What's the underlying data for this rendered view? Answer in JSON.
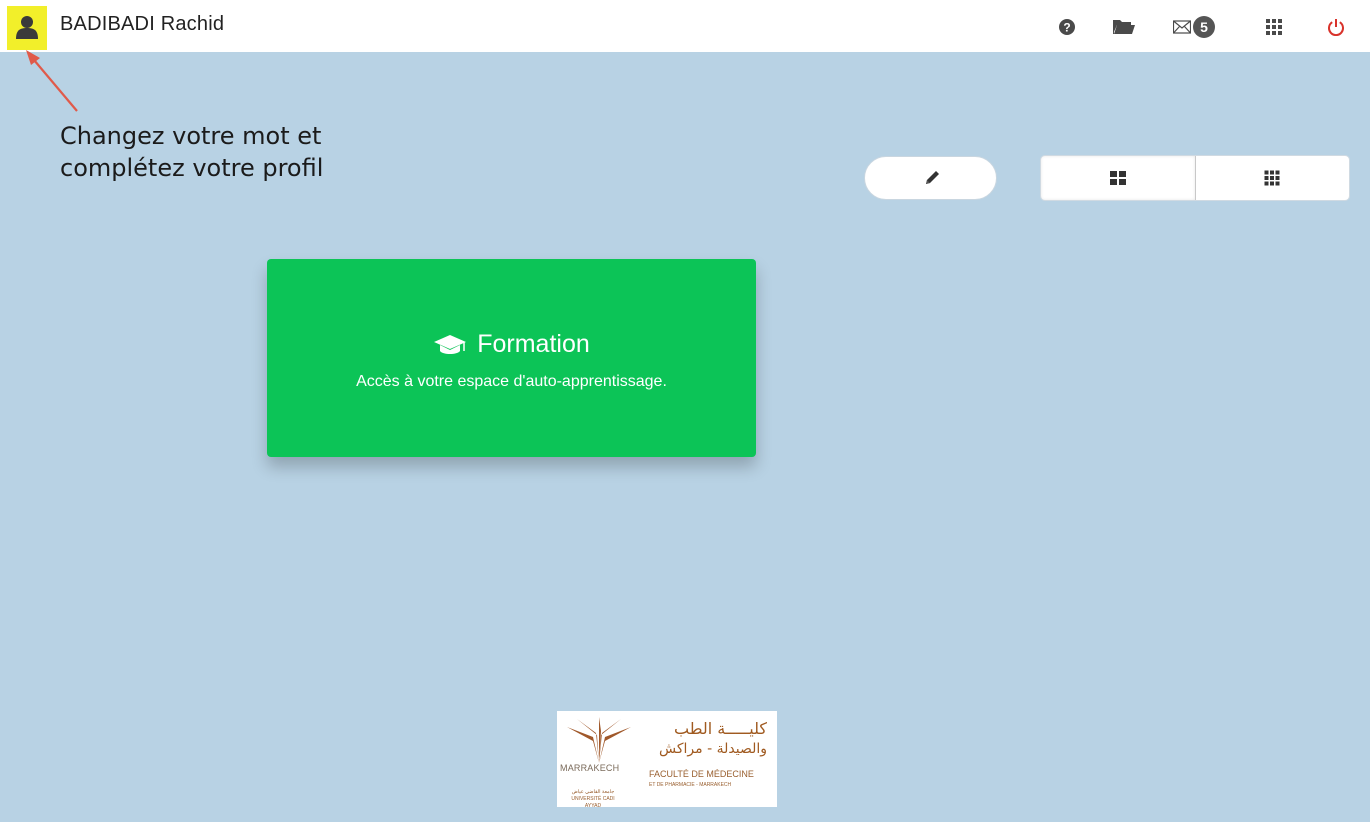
{
  "header": {
    "user_name": "BADIBADI Rachid",
    "mail_count": "5",
    "icons": [
      "user-icon",
      "help-icon",
      "folder-open-icon",
      "mail-icon",
      "apps-grid-icon",
      "power-icon"
    ]
  },
  "annotation": {
    "text": "Changez votre mot et complétez votre profil"
  },
  "toolbar": {
    "icons": [
      "pencil-icon",
      "large-grid-icon",
      "small-grid-icon"
    ]
  },
  "tiles": [
    {
      "title": "Formation",
      "description": "Accès à votre espace d'auto-apprentissage.",
      "icon": "graduation-cap-icon",
      "color": "#0cc457"
    }
  ],
  "footer_logo": {
    "arabic_line1": "كليـــــة الطب",
    "arabic_line2": "والصيدلة - مراكش",
    "french_line1": "FACULTÉ DE MÉDECINE",
    "french_line2": "ET DE PHARMACIE - MARRAKECH",
    "city": "MARRAKECH",
    "university_line1": "جامعة القاضي عياض",
    "university_line2": "UNIVERSITÉ CADI AYYAD"
  },
  "colors": {
    "background": "#b8d2e4",
    "avatar_highlight": "#f2ef2a",
    "power": "#d9332b",
    "logo_brown": "#a05a20"
  }
}
